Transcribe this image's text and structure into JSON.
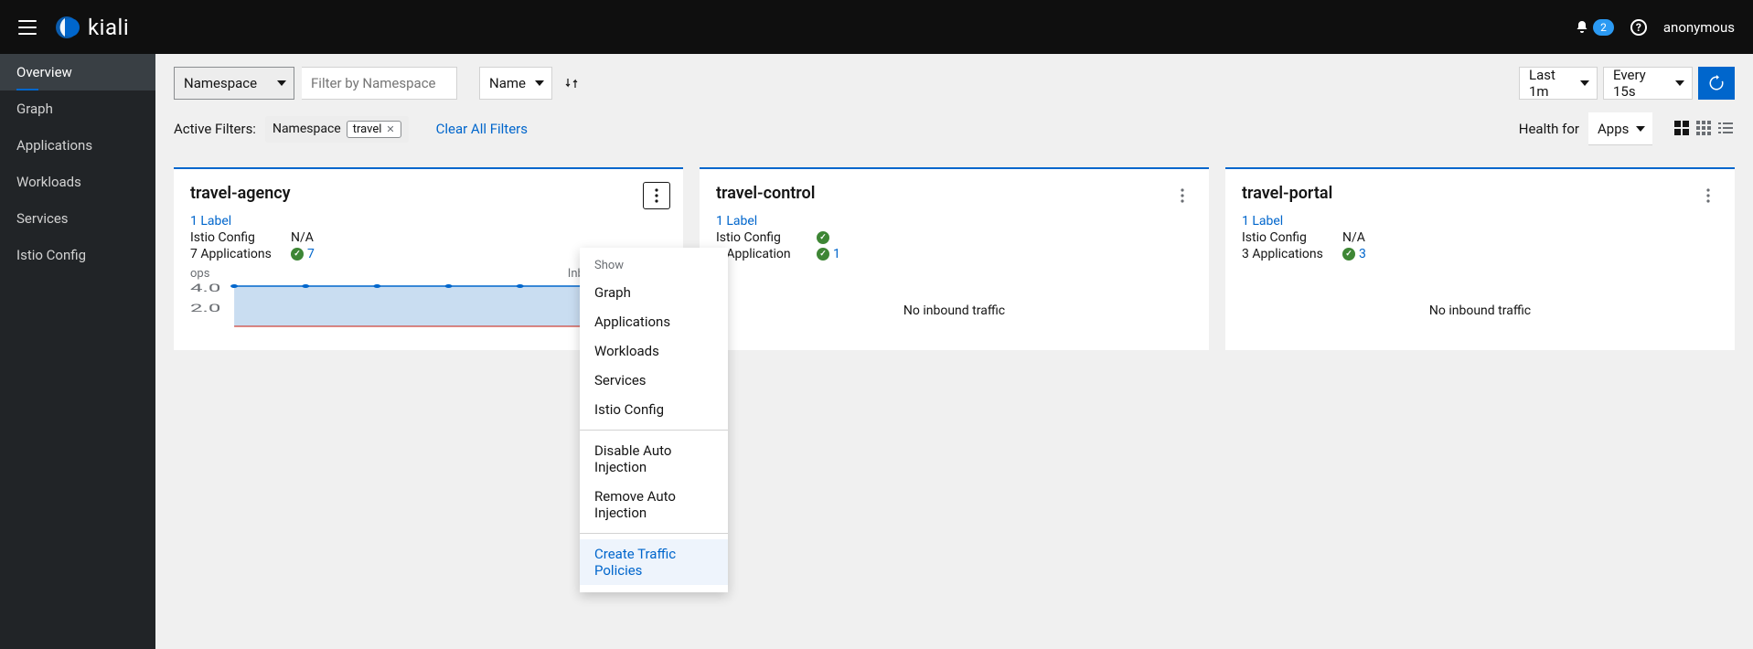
{
  "brand": "kiali",
  "notifications_count": "2",
  "user": "anonymous",
  "sidebar": {
    "items": [
      {
        "label": "Overview"
      },
      {
        "label": "Graph"
      },
      {
        "label": "Applications"
      },
      {
        "label": "Workloads"
      },
      {
        "label": "Services"
      },
      {
        "label": "Istio Config"
      }
    ]
  },
  "toolbar": {
    "namespace_select_label": "Namespace",
    "filter_placeholder": "Filter by Namespace",
    "sort_select_label": "Name",
    "time_range_label": "Last 1m",
    "refresh_interval_label": "Every 15s"
  },
  "filters": {
    "label": "Active Filters:",
    "chip_category": "Namespace",
    "chip_value": "travel",
    "clear_label": "Clear All Filters"
  },
  "health": {
    "label": "Health for",
    "select_label": "Apps"
  },
  "cards": [
    {
      "title": "travel-agency",
      "label_link": "1 Label",
      "istio_label": "Istio Config",
      "istio_value": "N/A",
      "apps_label": "7 Applications",
      "apps_count": "7",
      "chart": {
        "ops_label": "ops",
        "traffic_label": "Inbound traffic, 1m",
        "y_ticks": [
          "4.0",
          "2.0"
        ]
      }
    },
    {
      "title": "travel-control",
      "label_link": "1 Label",
      "istio_label": "Istio Config",
      "apps_label": "1 Application",
      "apps_count": "1",
      "no_traffic": "No inbound traffic"
    },
    {
      "title": "travel-portal",
      "label_link": "1 Label",
      "istio_label": "Istio Config",
      "istio_value": "N/A",
      "apps_label": "3 Applications",
      "apps_count": "3",
      "no_traffic": "No inbound traffic"
    }
  ],
  "dropdown": {
    "section_label": "Show",
    "items_show": [
      "Graph",
      "Applications",
      "Workloads",
      "Services",
      "Istio Config"
    ],
    "items_actions": [
      "Disable Auto Injection",
      "Remove Auto Injection"
    ],
    "highlighted": "Create Traffic Policies"
  },
  "chart_data": {
    "type": "area",
    "title": "Inbound traffic, 1m",
    "ylabel": "ops",
    "ylim": [
      0,
      4.0
    ],
    "x": [
      0,
      1,
      2,
      3,
      4,
      5,
      6
    ],
    "values": [
      4.0,
      3.9,
      3.95,
      3.9,
      4.0,
      3.9,
      3.95
    ]
  }
}
